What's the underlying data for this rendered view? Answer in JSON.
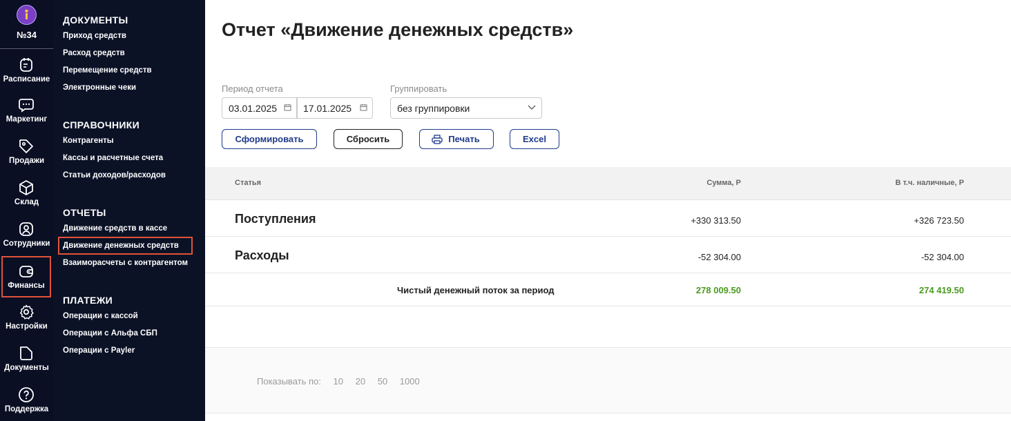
{
  "rail": {
    "club": "№34",
    "items": [
      {
        "label": "Расписание",
        "icon": "calendar-icon"
      },
      {
        "label": "Маркетинг",
        "icon": "chat-icon"
      },
      {
        "label": "Продажи",
        "icon": "tag-icon"
      },
      {
        "label": "Склад",
        "icon": "box-icon"
      },
      {
        "label": "Сотрудники",
        "icon": "user-icon"
      },
      {
        "label": "Финансы",
        "icon": "wallet-icon"
      },
      {
        "label": "Настройки",
        "icon": "gear-icon"
      },
      {
        "label": "Документы",
        "icon": "folder-icon"
      },
      {
        "label": "Поддержка",
        "icon": "help-icon"
      }
    ]
  },
  "menu": {
    "documents": {
      "heading": "ДОКУМЕНТЫ",
      "links": [
        "Приход средств",
        "Расход средств",
        "Перемещение средств",
        "Электронные чеки"
      ]
    },
    "references": {
      "heading": "СПРАВОЧНИКИ",
      "links": [
        "Контрагенты",
        "Кассы и расчетные счета",
        "Статьи доходов/расходов"
      ]
    },
    "reports": {
      "heading": "ОТЧЕТЫ",
      "links": [
        "Движение средств в кассе",
        "Движение денежных средств",
        "Взаиморасчеты с контрагентом"
      ]
    },
    "payments": {
      "heading": "ПЛАТЕЖИ",
      "links": [
        "Операции с кассой",
        "Операции с Альфа СБП",
        "Операции с Payler"
      ]
    }
  },
  "page": {
    "title": "Отчет «Движение денежных средств»",
    "period_label": "Период отчета",
    "date_from": "03.01.2025",
    "date_to": "17.01.2025",
    "group_label": "Группировать",
    "group_value": "без группировки"
  },
  "buttons": {
    "generate": "Сформировать",
    "reset": "Сбросить",
    "print": "Печать",
    "excel": "Excel"
  },
  "table": {
    "headers": {
      "article": "Статья",
      "sum": "Сумма, Р",
      "cash": "В т.ч. наличные, Р"
    },
    "rows": [
      {
        "name": "Поступления",
        "sum": "+330 313.50",
        "cash": "+326 723.50"
      },
      {
        "name": "Расходы",
        "sum": "-52 304.00",
        "cash": "-52 304.00"
      }
    ],
    "total": {
      "label": "Чистый денежный поток за период",
      "sum": "278 009.50",
      "cash": "274 419.50"
    }
  },
  "pager": {
    "label": "Показывать по:",
    "options": [
      "10",
      "20",
      "50",
      "1000"
    ]
  },
  "colors": {
    "accent": "#1f3a8a",
    "positive": "#4a9a1f",
    "highlight": "#e0533a",
    "sidebar": "#0a0f24"
  }
}
